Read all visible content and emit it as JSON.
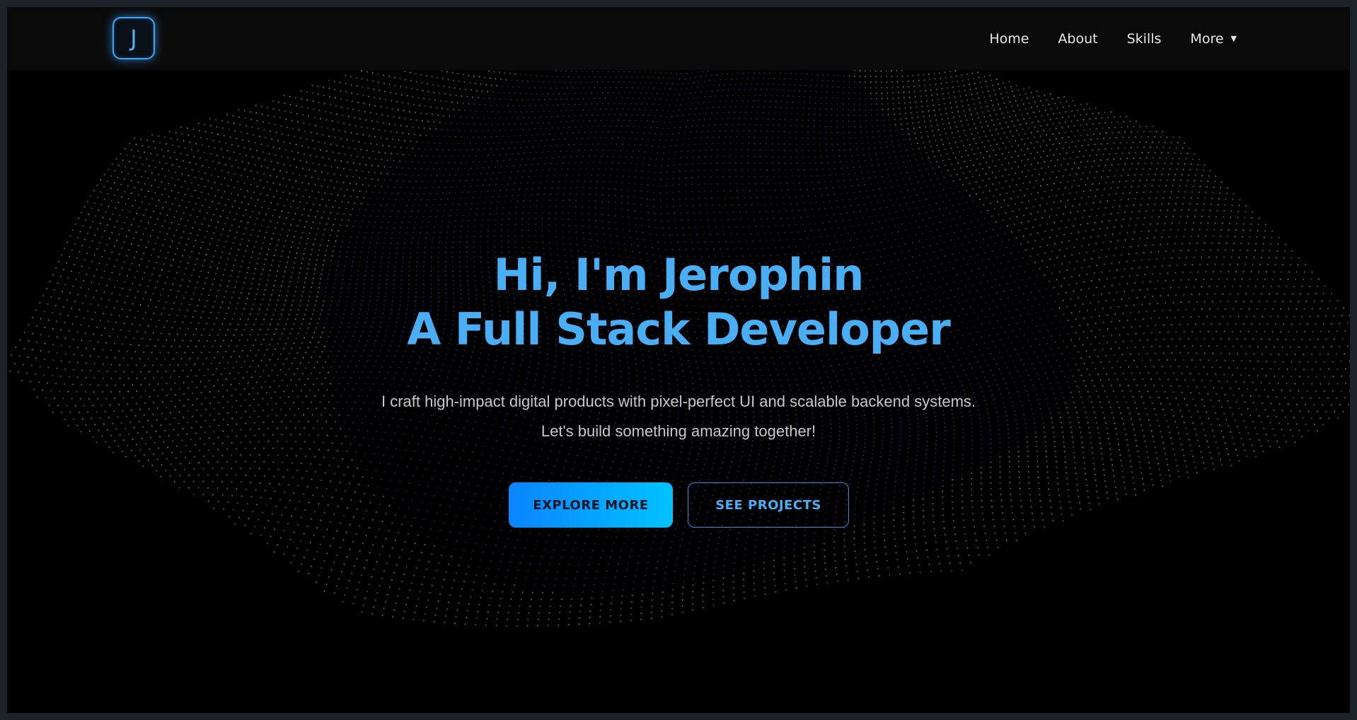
{
  "nav": {
    "logo_letter": "J",
    "links": [
      {
        "label": "Home"
      },
      {
        "label": "About"
      },
      {
        "label": "Skills"
      },
      {
        "label": "More",
        "caret": "▼"
      }
    ]
  },
  "hero": {
    "headline_line1": "Hi, I'm Jerophin",
    "headline_line2": "A Full Stack Developer",
    "subtitle": "I craft high-impact digital products with pixel-perfect UI and scalable backend systems. Let's build something amazing together!",
    "primary_button": "EXPLORE MORE",
    "secondary_button": "SEE PROJECTS"
  },
  "colors": {
    "accent": "#4aaef4",
    "button_gradient_start": "#0a84ff",
    "button_gradient_end": "#00c2ff",
    "background": "#000000",
    "navbar": "#0a0a0a",
    "frame": "#1d2228"
  }
}
